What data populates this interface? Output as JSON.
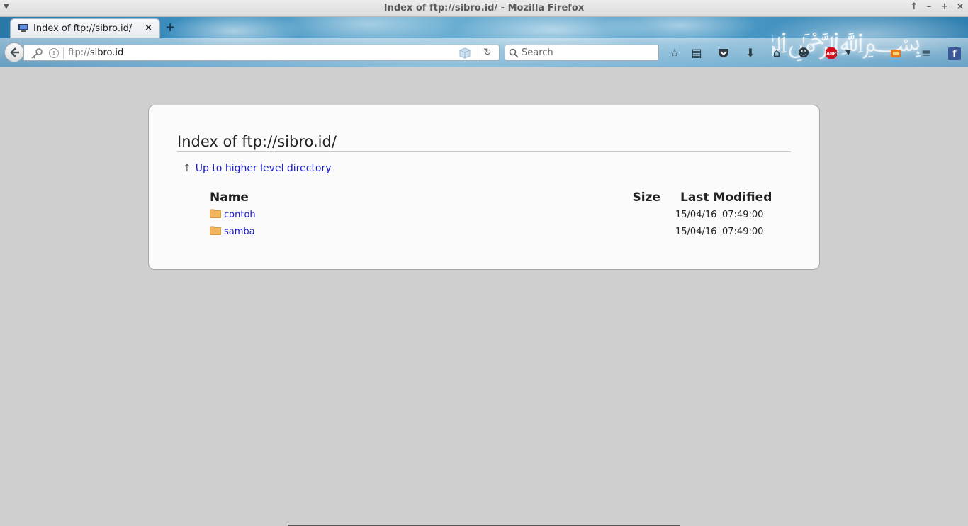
{
  "window": {
    "title": "Index of ftp://sibro.id/ - Mozilla Firefox"
  },
  "tabs": [
    {
      "label": "Index of ftp://sibro.id/",
      "favicon": "computer-icon",
      "active": true
    }
  ],
  "navbar": {
    "url_scheme": "ftp://",
    "url_host": "sibro.id",
    "search_placeholder": "Search",
    "toolbar_icons": [
      "bookmark-star-icon",
      "reading-list-icon",
      "pocket-icon",
      "download-icon",
      "home-icon",
      "smiley-icon",
      "adblock-icon",
      "dropdown-icon",
      "extension-icon",
      "menu-icon",
      "facebook-icon"
    ],
    "adblock_label": "ABP",
    "facebook_label": "f"
  },
  "page": {
    "heading": "Index of ftp://sibro.id/",
    "up_link": "Up to higher level directory",
    "columns": {
      "name": "Name",
      "size": "Size",
      "modified": "Last Modified"
    },
    "rows": [
      {
        "name": "contoh",
        "size": "",
        "date": "15/04/16",
        "time": "07:49:00"
      },
      {
        "name": "samba",
        "size": "",
        "date": "15/04/16",
        "time": "07:49:00"
      }
    ]
  },
  "colors": {
    "link": "#1a1ad0",
    "folder": "#f2b45c",
    "background": "#cfcfcf"
  }
}
